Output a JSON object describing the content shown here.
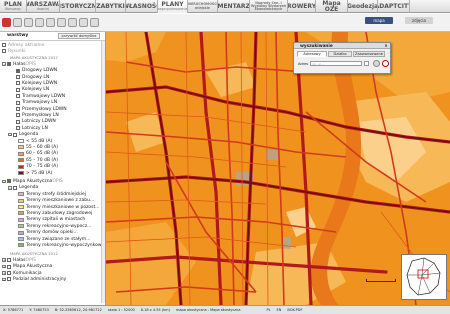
{
  "nav": {
    "items": [
      {
        "big": "PLAN",
        "small": "Warszawy"
      },
      {
        "big": "WARSZAWA",
        "small": "dawniej"
      },
      {
        "big": "HISTORYCZNA",
        "small": ""
      },
      {
        "big": "ZABYTKI",
        "small": ""
      },
      {
        "big": "WŁASNOŚĆ",
        "small": ""
      },
      {
        "big": "PLANY",
        "small": "zagospodarowania"
      },
      {
        "big": "",
        "small": "NIERUCHOMOŚCI miejskie"
      },
      {
        "big": "CMENTARZE",
        "small": ""
      },
      {
        "big": "",
        "small": "Nagrody Cen. i Wystawy Wydarzeń Ekonomicznych"
      },
      {
        "big": "ROWERY",
        "small": ""
      },
      {
        "big": "Mapa OZE",
        "small": ""
      },
      {
        "big": "Geodezja",
        "small": ""
      },
      {
        "big": "ADAPTCITY",
        "small": ""
      }
    ]
  },
  "toolbar": {
    "map_label": "mapa",
    "photos_label": "zdjęcia"
  },
  "sidebar": {
    "title": "warstwy",
    "restore_label": "przywróć domyślne",
    "layers": [
      {
        "label": "Adresy aktualne",
        "muted": true,
        "checked": false,
        "indent": 2
      },
      {
        "label": "Rysunki",
        "muted": true,
        "checked": false,
        "indent": 2
      },
      {
        "label": "MAPA AKUSTYCZNA 2017",
        "header": true,
        "indent": 10
      },
      {
        "label": "Hałas",
        "checked": true,
        "indent": 2,
        "expander": "−",
        "muted_suffix": " OPIS"
      },
      {
        "label": "Drogowy LDWN",
        "checked": true,
        "indent": 16
      },
      {
        "label": "Drogowy LN",
        "checked": false,
        "indent": 16
      },
      {
        "label": "Kolejowy LDWN",
        "checked": false,
        "indent": 16
      },
      {
        "label": "Kolejowy LN",
        "checked": false,
        "indent": 16
      },
      {
        "label": "Tramwajowy LDWN",
        "checked": false,
        "indent": 16
      },
      {
        "label": "Tramwajowy LN",
        "checked": false,
        "indent": 16
      },
      {
        "label": "Przemysłowy LDWN",
        "checked": false,
        "indent": 16
      },
      {
        "label": "Przemysłowy LN",
        "checked": false,
        "indent": 16
      },
      {
        "label": "Lotniczy LDWN",
        "checked": false,
        "indent": 16
      },
      {
        "label": "Lotniczy LN",
        "checked": false,
        "indent": 16
      },
      {
        "label": "Legenda",
        "checked": false,
        "indent": 8,
        "expander": "−"
      }
    ],
    "legend_noise": [
      {
        "label": "< 55 dB (A)",
        "color": "#ffffff"
      },
      {
        "label": "55 – 60 dB (A)",
        "color": "#f8c98a"
      },
      {
        "label": "60 – 65 dB (A)",
        "color": "#f5a23a"
      },
      {
        "label": "65 – 70 dB (A)",
        "color": "#e56a12"
      },
      {
        "label": "70 – 75 dB (A)",
        "color": "#c4281a"
      },
      {
        "label": "> 75 dB (A)",
        "color": "#7a0d12"
      }
    ],
    "layers2": [
      {
        "label": "Mapa Akustyczna",
        "checked": true,
        "indent": 2,
        "expander": "−",
        "muted_suffix": " OPIS"
      },
      {
        "label": "Legenda",
        "checked": false,
        "indent": 8,
        "expander": "−"
      }
    ],
    "legend_zones": [
      {
        "label": "Tereny strefy śródmiejskiej",
        "color": "#e8b8b8"
      },
      {
        "label": "Tereny mieszkaniowe z zabu...",
        "color": "#f0d060"
      },
      {
        "label": "Tereny mieszkaniowe w pozost...",
        "color": "#f4e79a"
      },
      {
        "label": "Tereny zabudowy zagrodowej",
        "color": "#d7a64e"
      },
      {
        "label": "Tereny szpitali w miastach",
        "color": "#e5a0c8"
      },
      {
        "label": "Tereny rekreacyjno-wypocz...",
        "color": "#9fcf80"
      },
      {
        "label": "Tereny domów opieki...",
        "color": "#c7a0e0"
      },
      {
        "label": "Tereny związane ze stałym...",
        "color": "#a0c8e8"
      },
      {
        "label": "Tereny rekreacyjno-wypoczynkowe",
        "color": "#7fb86a"
      }
    ],
    "layers3": [
      {
        "label": "MAPA AKUSTYCZNA 2012",
        "header": true,
        "indent": 10
      },
      {
        "label": "Hałas",
        "checked": false,
        "indent": 2,
        "expander": "+",
        "muted_suffix": " OPIS"
      },
      {
        "label": "Mapa Akustyczna",
        "checked": false,
        "indent": 2,
        "expander": "+"
      },
      {
        "label": "Komunikacja",
        "checked": false,
        "indent": 2,
        "expander": "+"
      },
      {
        "label": "Podział administracyjny",
        "checked": false,
        "indent": 2,
        "expander": "+"
      }
    ]
  },
  "dialog": {
    "title": "wyszukiwanie",
    "tabs": [
      "Adresowy",
      "Działka",
      "Zaawansowane"
    ],
    "address_label": "Adres",
    "address_placeholder": "np. ul. ..."
  },
  "status": {
    "x": "X: 5786771",
    "y": "Y: 7480753",
    "coords": "B: 52.2565612, 20.981722",
    "scale": "skala 1 : 52000",
    "dims": "8.18 x 4.55 (km)",
    "layer": "mapa akustyczna - Mapa akustyczna",
    "lang_pl": "PL",
    "lang_en": "EN",
    "bok": "BOK-PDF"
  }
}
